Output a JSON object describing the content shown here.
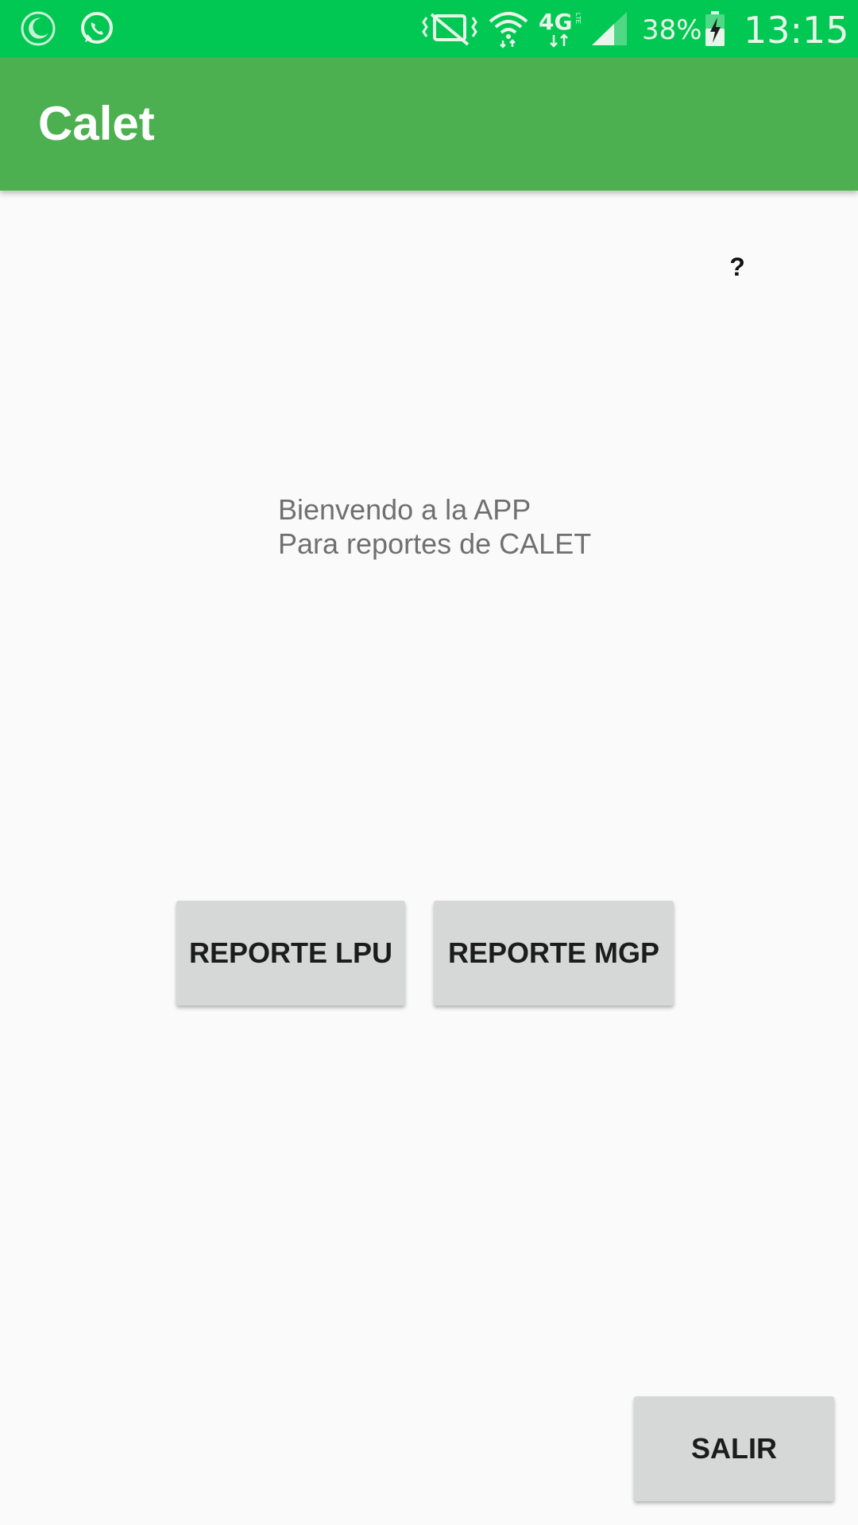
{
  "status_bar": {
    "battery_percent": "38%",
    "time": "13:15",
    "network_type": "4G",
    "network_sub": "LTE",
    "icons": [
      "moon-icon",
      "whatsapp-icon",
      "vibrate-icon",
      "wifi-icon",
      "4g-lte-icon",
      "signal-icon",
      "battery-charging-icon"
    ],
    "color": "#00c853"
  },
  "app_bar": {
    "title": "Calet",
    "color": "#4caf50"
  },
  "help": {
    "label": "?"
  },
  "welcome": {
    "line1": "Bienvendo a la APP",
    "line2": "Para reportes de CALET"
  },
  "buttons": {
    "lpu": "REPORTE LPU",
    "mgp": "REPORTE MGP",
    "salir": "SALIR"
  }
}
